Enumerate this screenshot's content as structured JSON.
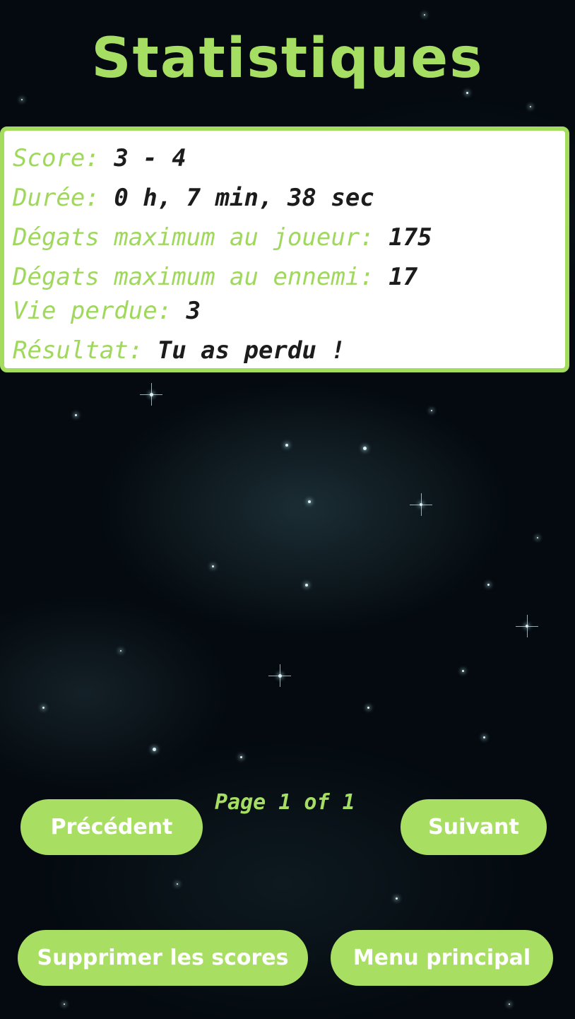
{
  "title": "Statistiques",
  "stats": {
    "score": {
      "label": "Score:",
      "value": "3 - 4"
    },
    "duration": {
      "label": "Durée:",
      "value": "0 h, 7 min, 38 sec"
    },
    "max_damage_player": {
      "label": "Dégats maximum au joueur:",
      "value": "175"
    },
    "max_damage_enemy": {
      "label": "Dégats maximum au ennemi:",
      "value": "17"
    },
    "lives_lost": {
      "label": "Vie perdue:",
      "value": "3"
    },
    "result": {
      "label": "Résultat:",
      "value": "Tu as perdu !"
    }
  },
  "pagination": {
    "previous_label": "Précédent",
    "page_info": "Page 1 of 1",
    "next_label": "Suivant"
  },
  "actions": {
    "delete_scores_label": "Supprimer les scores",
    "main_menu_label": "Menu principal"
  },
  "colors": {
    "accent_green": "#a6de63",
    "background": "#040a0f",
    "panel": "#ffffff"
  }
}
